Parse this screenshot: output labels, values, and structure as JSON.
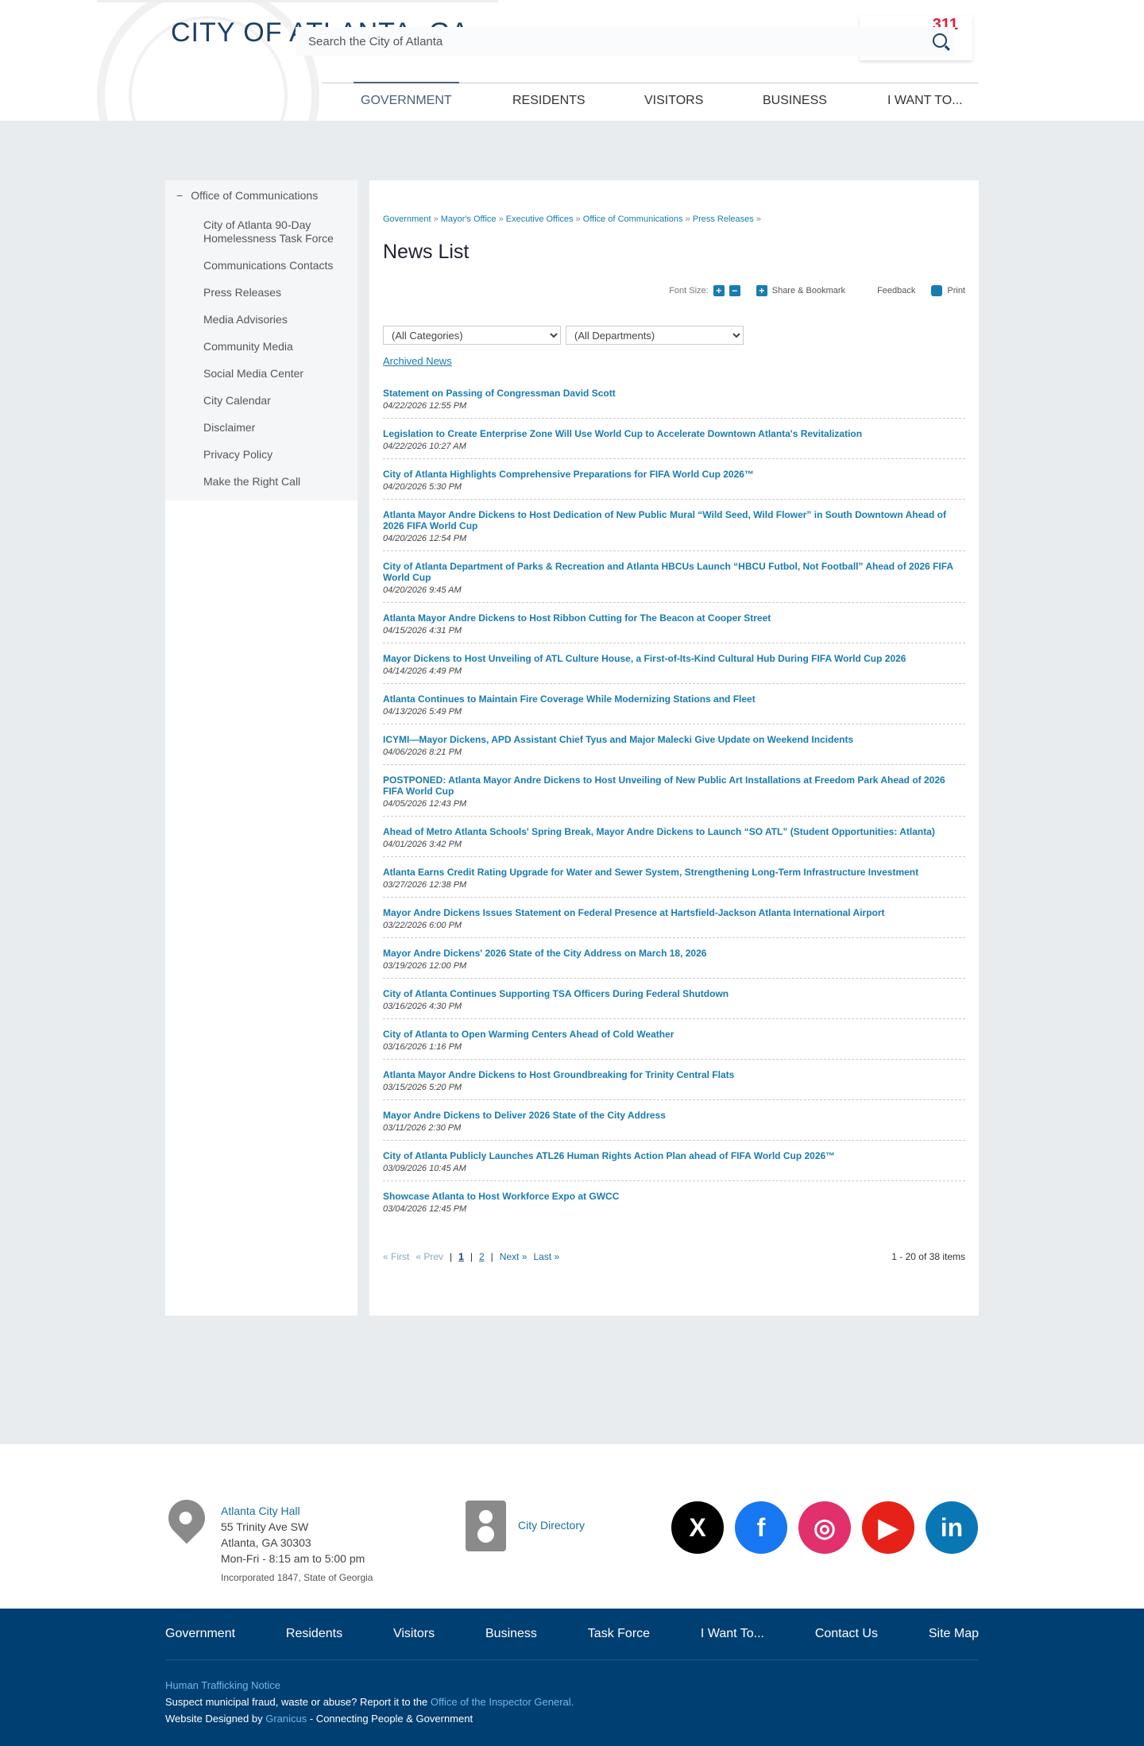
{
  "header": {
    "logo_text": "CITY OF ATLANTA, GA",
    "search_placeholder": "Search the City of Atlanta",
    "badge": "311"
  },
  "nav": [
    "GOVERNMENT",
    "RESIDENTS",
    "VISITORS",
    "BUSINESS",
    "I WANT TO..."
  ],
  "sidebar": {
    "heading": "Office of Communications",
    "toggle": "−",
    "items": [
      "City of Atlanta 90-Day Homelessness Task Force",
      "Communications Contacts",
      "Press Releases",
      "Media Advisories",
      "Community Media",
      "Social Media Center",
      "City Calendar",
      "Disclaimer",
      "Privacy Policy",
      "Make the Right Call"
    ]
  },
  "breadcrumb": [
    "Government",
    "Mayor's Office",
    "Executive Offices",
    "Office of Communications",
    "Press Releases"
  ],
  "title": "News List",
  "toolbar": {
    "font_size": "Font Size:",
    "share": "Share & Bookmark",
    "feedback": "Feedback",
    "print": "Print"
  },
  "filters": {
    "category": "(All Categories)",
    "department": "(All Departments)"
  },
  "archived": "Archived News",
  "news": [
    {
      "title": "Statement on Passing of Congressman David Scott",
      "date": "04/22/2026 12:55 PM"
    },
    {
      "title": "Legislation to Create Enterprise Zone Will Use World Cup to Accelerate Downtown Atlanta's Revitalization",
      "date": "04/22/2026 10:27 AM"
    },
    {
      "title": "City of Atlanta Highlights Comprehensive Preparations for FIFA World Cup 2026™",
      "date": "04/20/2026 5:30 PM"
    },
    {
      "title": "Atlanta Mayor Andre Dickens to Host Dedication of New Public Mural “Wild Seed, Wild Flower” in South Downtown Ahead of 2026 FIFA World Cup",
      "date": "04/20/2026 12:54 PM"
    },
    {
      "title": "City of Atlanta Department of Parks & Recreation and Atlanta HBCUs Launch “HBCU Futbol, Not Football” Ahead of 2026 FIFA World Cup",
      "date": "04/20/2026 9:45 AM"
    },
    {
      "title": "Atlanta Mayor Andre Dickens to Host Ribbon Cutting for The Beacon at Cooper Street",
      "date": "04/15/2026 4:31 PM"
    },
    {
      "title": "Mayor Dickens to Host Unveiling of ATL Culture House, a First-of-Its-Kind Cultural Hub During FIFA World Cup 2026",
      "date": "04/14/2026 4:49 PM"
    },
    {
      "title": "Atlanta Continues to Maintain Fire Coverage While Modernizing Stations and Fleet",
      "date": "04/13/2026 5:49 PM"
    },
    {
      "title": "ICYMI—Mayor Dickens, APD Assistant Chief Tyus and Major Malecki Give Update on Weekend Incidents",
      "date": "04/06/2026 8:21 PM"
    },
    {
      "title": "POSTPONED: Atlanta Mayor Andre Dickens to Host Unveiling of New Public Art Installations at Freedom Park Ahead of 2026 FIFA World Cup",
      "date": "04/05/2026 12:43 PM"
    },
    {
      "title": "Ahead of Metro Atlanta Schools' Spring Break, Mayor Andre Dickens to Launch “SO ATL” (Student Opportunities: Atlanta)",
      "date": "04/01/2026 3:42 PM"
    },
    {
      "title": "Atlanta Earns Credit Rating Upgrade for Water and Sewer System, Strengthening Long-Term Infrastructure Investment",
      "date": "03/27/2026 12:38 PM"
    },
    {
      "title": "Mayor Andre Dickens Issues Statement on Federal Presence at Hartsfield-Jackson Atlanta International Airport",
      "date": "03/22/2026 6:00 PM"
    },
    {
      "title": "Mayor Andre Dickens' 2026 State of the City Address on March 18, 2026",
      "date": "03/19/2026 12:00 PM"
    },
    {
      "title": "City of Atlanta Continues Supporting TSA Officers During Federal Shutdown",
      "date": "03/16/2026 4:30 PM"
    },
    {
      "title": "City of Atlanta to Open Warming Centers Ahead of Cold Weather",
      "date": "03/16/2026 1:16 PM"
    },
    {
      "title": "Atlanta Mayor Andre Dickens to Host Groundbreaking for Trinity Central Flats",
      "date": "03/15/2026 5:20 PM"
    },
    {
      "title": "Mayor Andre Dickens to Deliver 2026 State of the City Address",
      "date": "03/11/2026 2:30 PM"
    },
    {
      "title": "City of Atlanta Publicly Launches ATL26 Human Rights Action Plan ahead of FIFA World Cup 2026™",
      "date": "03/09/2026 10:45 AM"
    },
    {
      "title": "Showcase Atlanta to Host Workforce Expo at GWCC",
      "date": "03/04/2026 12:45 PM"
    }
  ],
  "pager": {
    "first": "« First",
    "prev": "« Prev",
    "pages": [
      "1",
      "2"
    ],
    "next": "Next »",
    "last": "Last »",
    "count": "1 - 20 of 38 items"
  },
  "footer": {
    "address": {
      "name": "Atlanta City Hall",
      "street": "55 Trinity Ave SW",
      "city": "Atlanta, GA 30303",
      "hours": "Mon-Fri - 8:15 am to 5:00 pm",
      "incorporated": "Incorporated 1847, State of Georgia"
    },
    "directory": "City Directory",
    "social": [
      {
        "name": "x",
        "glyph": "X",
        "color": "#000000"
      },
      {
        "name": "facebook",
        "glyph": "f",
        "color": "#1877f2"
      },
      {
        "name": "instagram",
        "glyph": "◎",
        "color": "#e1306c"
      },
      {
        "name": "youtube",
        "glyph": "▶",
        "color": "#e62117"
      },
      {
        "name": "linkedin",
        "glyph": "in",
        "color": "#0a77b5"
      }
    ],
    "links": [
      "Government",
      "Residents",
      "Visitors",
      "Business",
      "Task Force",
      "I Want To...",
      "Contact Us",
      "Site Map"
    ],
    "trafficking": "Human Trafficking Notice",
    "fraud_text": "Suspect municipal fraud, waste or abuse? Report it to the ",
    "fraud_link": "Office of the Inspector General.",
    "designed_text": "Website Designed by ",
    "designed_link": "Granicus",
    "designed_suffix": " - Connecting People & Government"
  }
}
